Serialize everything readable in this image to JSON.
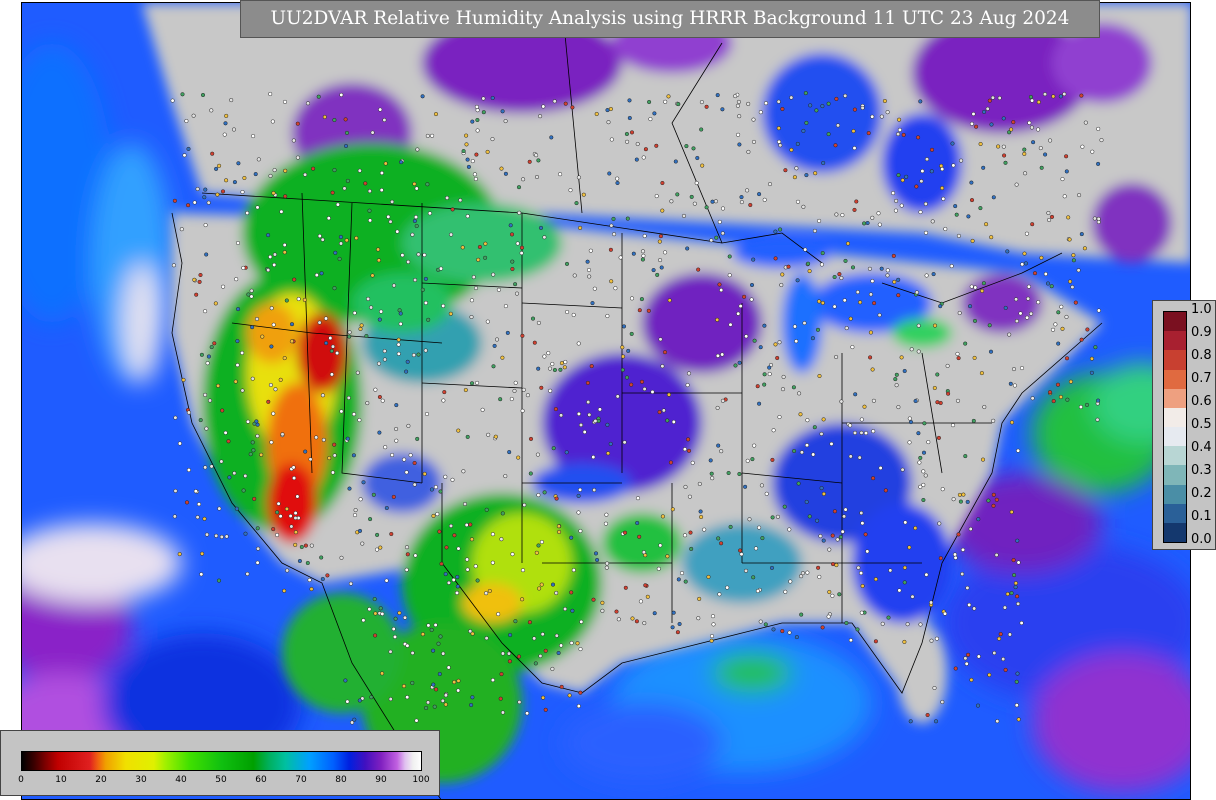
{
  "title": "UU2DVAR Relative Humidity Analysis using HRRR Background 11 UTC 23 Aug 2024",
  "legend_rh": {
    "labels": [
      "1.0",
      "0.9",
      "0.8",
      "0.7",
      "0.6",
      "0.5",
      "0.4",
      "0.3",
      "0.2",
      "0.1",
      "0.0"
    ],
    "colors": [
      "#7a1020",
      "#a82030",
      "#c84030",
      "#e06a40",
      "#eea080",
      "#f2ece8",
      "#e6eaf0",
      "#b8d6d4",
      "#7fb6b8",
      "#4a8ea6",
      "#2a6098",
      "#14386e"
    ]
  },
  "legend_pct": {
    "labels": [
      "0",
      "10",
      "20",
      "30",
      "40",
      "50",
      "60",
      "70",
      "80",
      "90",
      "100"
    ]
  },
  "colors": {
    "ocean_blue": "#1a5aff",
    "ocean_deep": "#0a2ad8",
    "purple": "#7a10b8",
    "magenta": "#c040e0",
    "green": "#10b020",
    "yellow": "#f0e010",
    "orange": "#f08010",
    "red": "#d01010",
    "gray": "#c8c8c8"
  }
}
